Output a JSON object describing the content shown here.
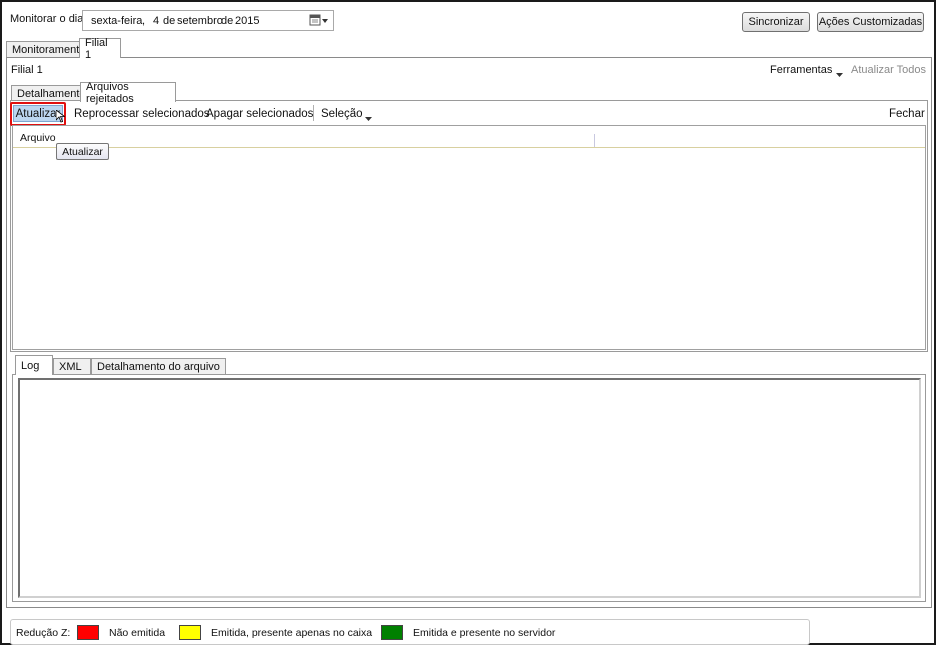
{
  "header": {
    "monitor_label": "Monitorar o dia",
    "date_weekday": "sexta-feira",
    "date_sep": ",",
    "date_day": "4",
    "date_of1": "de",
    "date_month": "setembro",
    "date_of2": "de",
    "date_year": "2015",
    "sync_button": "Sincronizar",
    "custom_actions_button": "Ações Customizadas"
  },
  "main_tabs": [
    {
      "label": "Monitoramento",
      "active": false
    },
    {
      "label": "Filial 1",
      "active": true
    }
  ],
  "branch": {
    "title": "Filial 1",
    "tools_label": "Ferramentas",
    "update_all_label": "Atualizar Todos"
  },
  "sub_tabs": [
    {
      "label": "Detalhamento",
      "active": false
    },
    {
      "label": "Arquivos rejeitados",
      "active": true
    }
  ],
  "toolbar": {
    "update": "Atualizar",
    "reprocess": "Reprocessar selecionados",
    "delete": "Apagar selecionados",
    "selection": "Seleção",
    "close": "Fechar",
    "tooltip": "Atualizar"
  },
  "grid": {
    "columns": [
      "Arquivo"
    ]
  },
  "bottom_tabs": [
    {
      "label": "Log",
      "active": true
    },
    {
      "label": "XML",
      "active": false
    },
    {
      "label": "Detalhamento do arquivo",
      "active": false
    }
  ],
  "legend": {
    "title": "Redução Z:",
    "items": [
      {
        "label": "Não emitida",
        "color": "#ff0000"
      },
      {
        "label": "Emitida, presente apenas no caixa",
        "color": "#ffff00"
      },
      {
        "label": "Emitida e presente no servidor",
        "color": "#008000"
      }
    ]
  }
}
